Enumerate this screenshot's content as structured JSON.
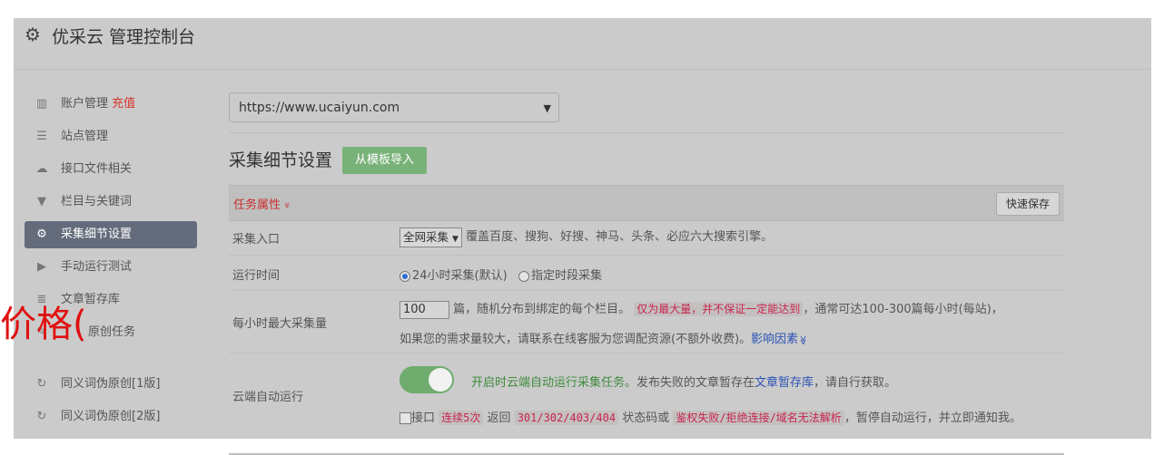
{
  "header": {
    "icon": "gear-icon",
    "title": "优采云 管理控制台"
  },
  "sidebar": {
    "items": [
      {
        "icon": "bar-chart-icon",
        "label": "账户管理",
        "extra": "充值"
      },
      {
        "icon": "server-icon",
        "label": "站点管理"
      },
      {
        "icon": "cloud-upload-icon",
        "label": "接口文件相关"
      },
      {
        "icon": "filter-icon",
        "label": "栏目与关键词"
      },
      {
        "icon": "gears-icon",
        "label": "采集细节设置",
        "active": true
      },
      {
        "icon": "play-circle-icon",
        "label": "手动运行测试"
      },
      {
        "icon": "database-icon",
        "label": "文章暂存库"
      },
      {
        "icon": "edit-icon",
        "label": "原创任务"
      },
      {
        "icon": "refresh-icon",
        "label": "同义词伪原创[1版]"
      },
      {
        "icon": "refresh-icon",
        "label": "同义词伪原创[2版]"
      }
    ]
  },
  "overlay": {
    "text": "价格("
  },
  "main": {
    "site_select": "https://www.ucaiyun.com",
    "section_title": "采集细节设置",
    "import_button": "从模板导入",
    "task_section": {
      "label": "任务属性",
      "chevron": "»",
      "quick_save": "快速保存"
    },
    "rows": {
      "entry": {
        "label": "采集入口",
        "select": "全网采集",
        "desc": "覆盖百度、搜狗、好搜、神马、头条、必应六大搜索引擎。"
      },
      "run_time": {
        "label": "运行时间",
        "opt1": "24小时采集(默认)",
        "opt2": "指定时段采集"
      },
      "max_per_hour": {
        "label": "每小时最大采集量",
        "value": "100",
        "text1": "篇，随机分布到绑定的每个栏目。",
        "warn": "仅为最大量，并不保证一定能达到",
        "text2": "，通常可达100-300篇每小时(每站)，",
        "text3": "如果您的需求量较大，请联系在线客服为您调配资源(不额外收费)。",
        "link": "影响因素",
        "link_icon": "≫"
      },
      "cloud_run": {
        "label": "云端自动运行",
        "green_text": "开启时云端自动运行采集任务。",
        "text1": "发布失败的文章暂存在",
        "link": "文章暂存库",
        "text2": "，请自行获取。",
        "cb_label": "接口",
        "warn1": "连续5次",
        "text3": "返回",
        "warn2": "301/302/403/404",
        "text4": "状态码或",
        "warn3": "鉴权失败/拒绝连接/域名无法解析",
        "text5": "，暂停自动运行，并立即通知我。"
      }
    }
  }
}
